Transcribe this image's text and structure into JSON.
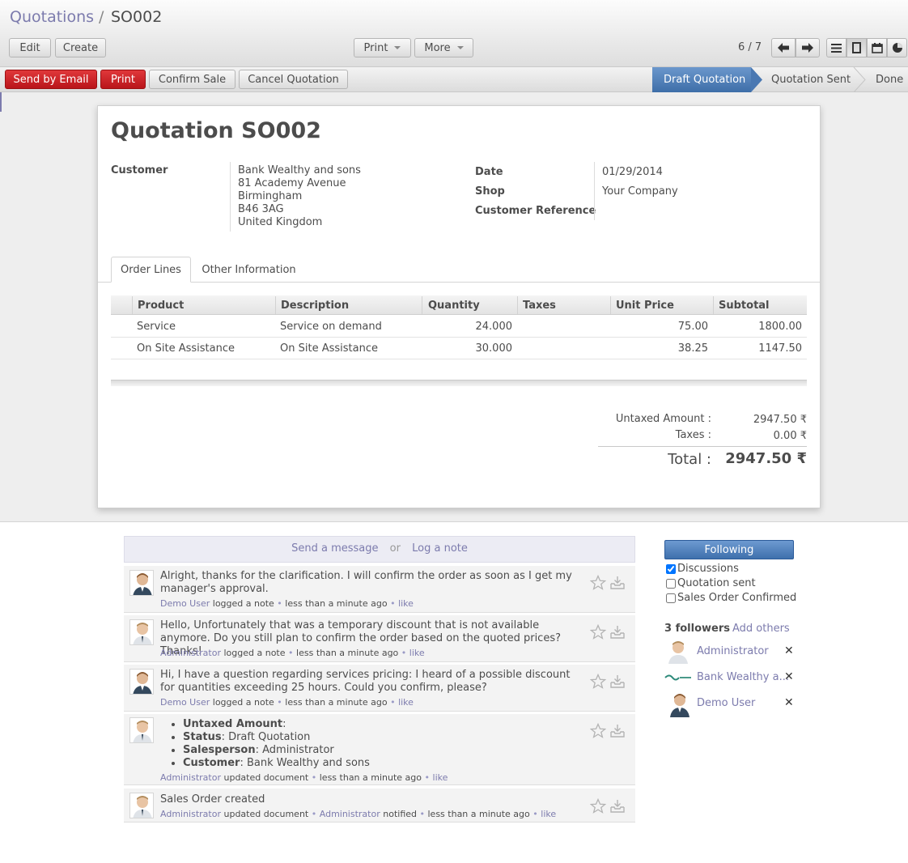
{
  "breadcrumb": {
    "root": "Quotations",
    "separator": "/",
    "current": "SO002"
  },
  "toolbar": {
    "edit": "Edit",
    "create": "Create",
    "print": "Print",
    "more": "More"
  },
  "pager": {
    "text": "6 / 7"
  },
  "actions": {
    "send_by_email": "Send by Email",
    "print": "Print",
    "confirm_sale": "Confirm Sale",
    "cancel_quotation": "Cancel Quotation"
  },
  "statusbar": {
    "draft": "Draft Quotation",
    "sent": "Quotation Sent",
    "done": "Done"
  },
  "form": {
    "title": "Quotation SO002",
    "customer_label": "Customer",
    "customer_name": "Bank Wealthy and sons",
    "address": [
      "81 Academy Avenue",
      "Birmingham",
      "B46 3AG",
      "United Kingdom"
    ],
    "date_label": "Date",
    "date_value": "01/29/2014",
    "shop_label": "Shop",
    "shop_value": "Your Company",
    "customer_ref_label": "Customer Reference"
  },
  "tabs": {
    "order_lines": "Order Lines",
    "other_info": "Other Information"
  },
  "order_lines": {
    "headers": [
      "Product",
      "Description",
      "Quantity",
      "Taxes",
      "Unit Price",
      "Subtotal"
    ],
    "rows": [
      {
        "product": "Service",
        "description": "Service on demand",
        "quantity": "24.000",
        "taxes": "",
        "unit_price": "75.00",
        "subtotal": "1800.00"
      },
      {
        "product": "On Site Assistance",
        "description": "On Site Assistance",
        "quantity": "30.000",
        "taxes": "",
        "unit_price": "38.25",
        "subtotal": "1147.50"
      }
    ]
  },
  "totals": {
    "untaxed_label": "Untaxed Amount :",
    "untaxed_value": "2947.50 ₹",
    "taxes_label": "Taxes :",
    "taxes_value": "0.00 ₹",
    "total_label": "Total :",
    "total_value": "2947.50 ₹"
  },
  "chatter": {
    "send_message": "Send a message",
    "or": "or",
    "log_note": "Log a note",
    "messages": [
      {
        "body": "Alright, thanks for the clarification. I will confirm the order as soon as I get my manager's approval.",
        "author": "Demo User",
        "action": "logged a note",
        "time": "less than a minute ago",
        "like": "like"
      },
      {
        "body": "Hello, Unfortunately that was a temporary discount that is not available anymore. Do you still plan to confirm the order based on the quoted prices? Thanks!",
        "author": "Administrator",
        "action": "logged a note",
        "time": "less than a minute ago",
        "like": "like"
      },
      {
        "body": "Hi, I have a question regarding services pricing: I heard of a possible discount for quantities exceeding 25 hours. Could you confirm, please?",
        "author": "Demo User",
        "action": "logged a note",
        "time": "less than a minute ago",
        "like": "like"
      },
      {
        "changes": [
          {
            "field": "Untaxed Amount",
            "value": ""
          },
          {
            "field": "Status",
            "value": "Draft Quotation"
          },
          {
            "field": "Salesperson",
            "value": "Administrator"
          },
          {
            "field": "Customer",
            "value": "Bank Wealthy and sons"
          }
        ],
        "author": "Administrator",
        "action": "updated document",
        "time": "less than a minute ago",
        "like": "like"
      },
      {
        "body": "Sales Order created",
        "author": "Administrator",
        "action": "updated document",
        "notified_user": "Administrator",
        "notified": "notified",
        "time": "less than a minute ago",
        "like": "like"
      }
    ]
  },
  "followers": {
    "following": "Following",
    "subtypes": [
      {
        "label": "Discussions",
        "checked": true
      },
      {
        "label": "Quotation sent",
        "checked": false
      },
      {
        "label": "Sales Order Confirmed",
        "checked": false
      }
    ],
    "count_label": "3 followers",
    "add_others": "Add others",
    "list": [
      {
        "name": "Administrator"
      },
      {
        "name": "Bank Wealthy a..."
      },
      {
        "name": "Demo User"
      }
    ]
  },
  "colors": {
    "link": "#7c7bad",
    "danger": "#c1191e",
    "active_stage": "#4a78b2"
  }
}
